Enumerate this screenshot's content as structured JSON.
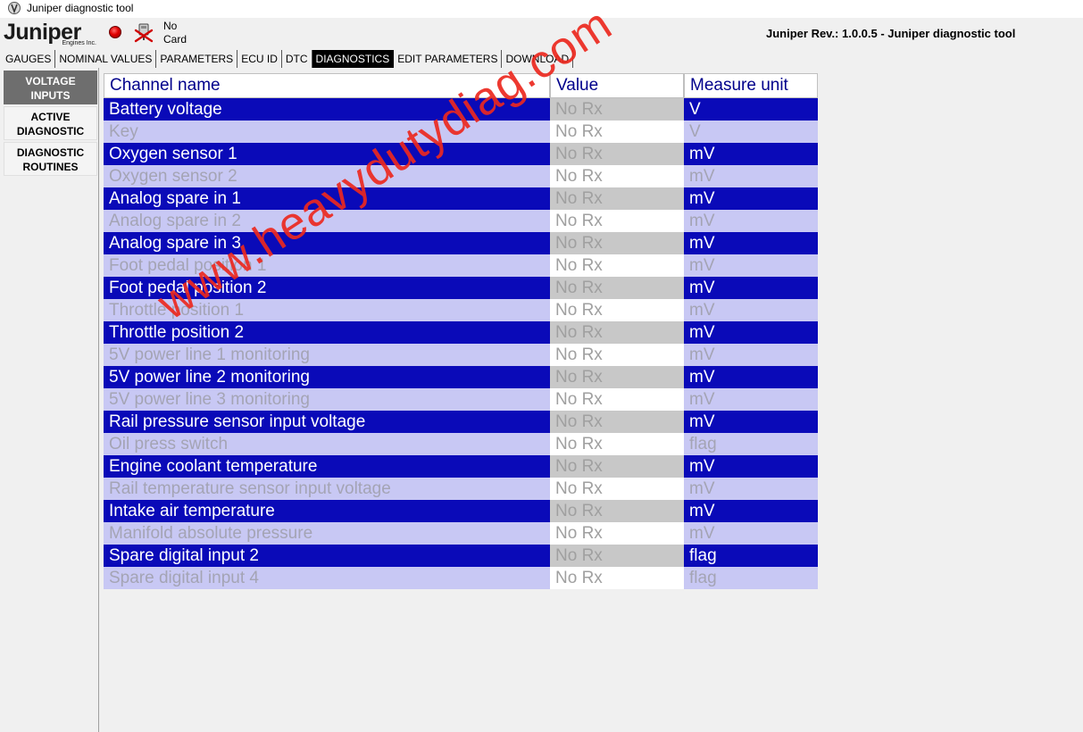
{
  "window": {
    "title": "Juniper diagnostic tool"
  },
  "header": {
    "logo_text": "Juniper",
    "logo_sub": "Engines Inc.",
    "card_status": "No Card",
    "card_line1": "No",
    "card_line2": "Card",
    "revision": "Juniper Rev.: 1.0.0.5 - Juniper diagnostic tool"
  },
  "tabs": [
    {
      "label": "GAUGES"
    },
    {
      "label": "NOMINAL VALUES"
    },
    {
      "label": "PARAMETERS"
    },
    {
      "label": "ECU ID"
    },
    {
      "label": "DTC"
    },
    {
      "label": "DIAGNOSTICS",
      "active": true
    },
    {
      "label": "EDIT PARAMETERS"
    },
    {
      "label": "DOWNLOAD"
    }
  ],
  "sidebar": {
    "items": [
      {
        "line1": "VOLTAGE",
        "line2": "INPUTS",
        "active": true
      },
      {
        "line1": "ACTIVE",
        "line2": "DIAGNOSTIC"
      },
      {
        "line1": "DIAGNOSTIC",
        "line2": "ROUTINES"
      }
    ]
  },
  "table": {
    "headers": [
      "Channel name",
      "Value",
      "Measure unit"
    ],
    "rows": [
      {
        "name": "Battery voltage",
        "value": "No Rx",
        "unit": "V"
      },
      {
        "name": "Key",
        "value": "No Rx",
        "unit": "V"
      },
      {
        "name": "Oxygen sensor 1",
        "value": "No Rx",
        "unit": "mV"
      },
      {
        "name": "Oxygen sensor 2",
        "value": "No Rx",
        "unit": "mV"
      },
      {
        "name": "Analog spare in 1",
        "value": "No Rx",
        "unit": "mV"
      },
      {
        "name": "Analog spare in 2",
        "value": "No Rx",
        "unit": "mV"
      },
      {
        "name": "Analog spare in 3",
        "value": "No Rx",
        "unit": "mV"
      },
      {
        "name": "Foot pedal position 1",
        "value": "No Rx",
        "unit": "mV"
      },
      {
        "name": "Foot pedal position 2",
        "value": "No Rx",
        "unit": "mV"
      },
      {
        "name": "Throttle position 1",
        "value": "No Rx",
        "unit": "mV"
      },
      {
        "name": "Throttle position 2",
        "value": "No Rx",
        "unit": "mV"
      },
      {
        "name": "5V power line 1 monitoring",
        "value": "No Rx",
        "unit": "mV"
      },
      {
        "name": "5V power line 2 monitoring",
        "value": "No Rx",
        "unit": "mV"
      },
      {
        "name": "5V power line 3 monitoring",
        "value": "No Rx",
        "unit": "mV"
      },
      {
        "name": "Rail pressure sensor input voltage",
        "value": "No Rx",
        "unit": "mV"
      },
      {
        "name": "Oil press switch",
        "value": "No Rx",
        "unit": "flag"
      },
      {
        "name": "Engine coolant temperature",
        "value": "No Rx",
        "unit": "mV"
      },
      {
        "name": "Rail temperature sensor input voltage",
        "value": "No Rx",
        "unit": "mV"
      },
      {
        "name": "Intake air temperature",
        "value": "No Rx",
        "unit": "mV"
      },
      {
        "name": "Manifold absolute pressure",
        "value": "No Rx",
        "unit": "mV"
      },
      {
        "name": "Spare digital input 2",
        "value": "No Rx",
        "unit": "flag"
      },
      {
        "name": "Spare digital input 4",
        "value": "No Rx",
        "unit": "flag"
      }
    ]
  },
  "watermark": {
    "text": "www.heavydutydiag.com"
  },
  "colors": {
    "row_dark": "#0a0ab8",
    "row_light": "#c8c8f4",
    "header_text": "#00008b",
    "watermark": "#eb281e",
    "status_lamp": "#e00000"
  },
  "icons": {
    "app": "juniper-app-icon",
    "status": "red-status-lamp-icon",
    "card": "card-disconnected-icon"
  }
}
